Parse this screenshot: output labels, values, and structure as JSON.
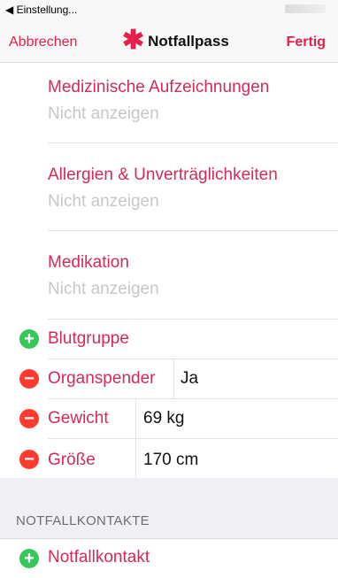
{
  "status_bar": {
    "back_label": "◀ Einstellung..."
  },
  "nav": {
    "cancel": "Abbrechen",
    "title": "Notfallpass",
    "done": "Fertig"
  },
  "sections": [
    {
      "title": "Medizinische Aufzeichnungen",
      "value": "Nicht anzeigen"
    },
    {
      "title": "Allergien & Unverträglichkeiten",
      "value": "Nicht anzeigen"
    },
    {
      "title": "Medikation",
      "value": "Nicht anzeigen"
    }
  ],
  "fields": [
    {
      "label": "Blutgruppe",
      "action": "add",
      "value": ""
    },
    {
      "label": "Organspender",
      "action": "remove",
      "value": "Ja"
    },
    {
      "label": "Gewicht",
      "action": "remove",
      "value": "69 kg"
    },
    {
      "label": "Größe",
      "action": "remove",
      "value": "170 cm"
    }
  ],
  "emergency": {
    "header": "NOTFALLKONTAKTE",
    "add_label": "Notfallkontakt"
  },
  "colors": {
    "accent": "#e5204a",
    "add": "#37c659",
    "remove": "#ff3b30"
  }
}
